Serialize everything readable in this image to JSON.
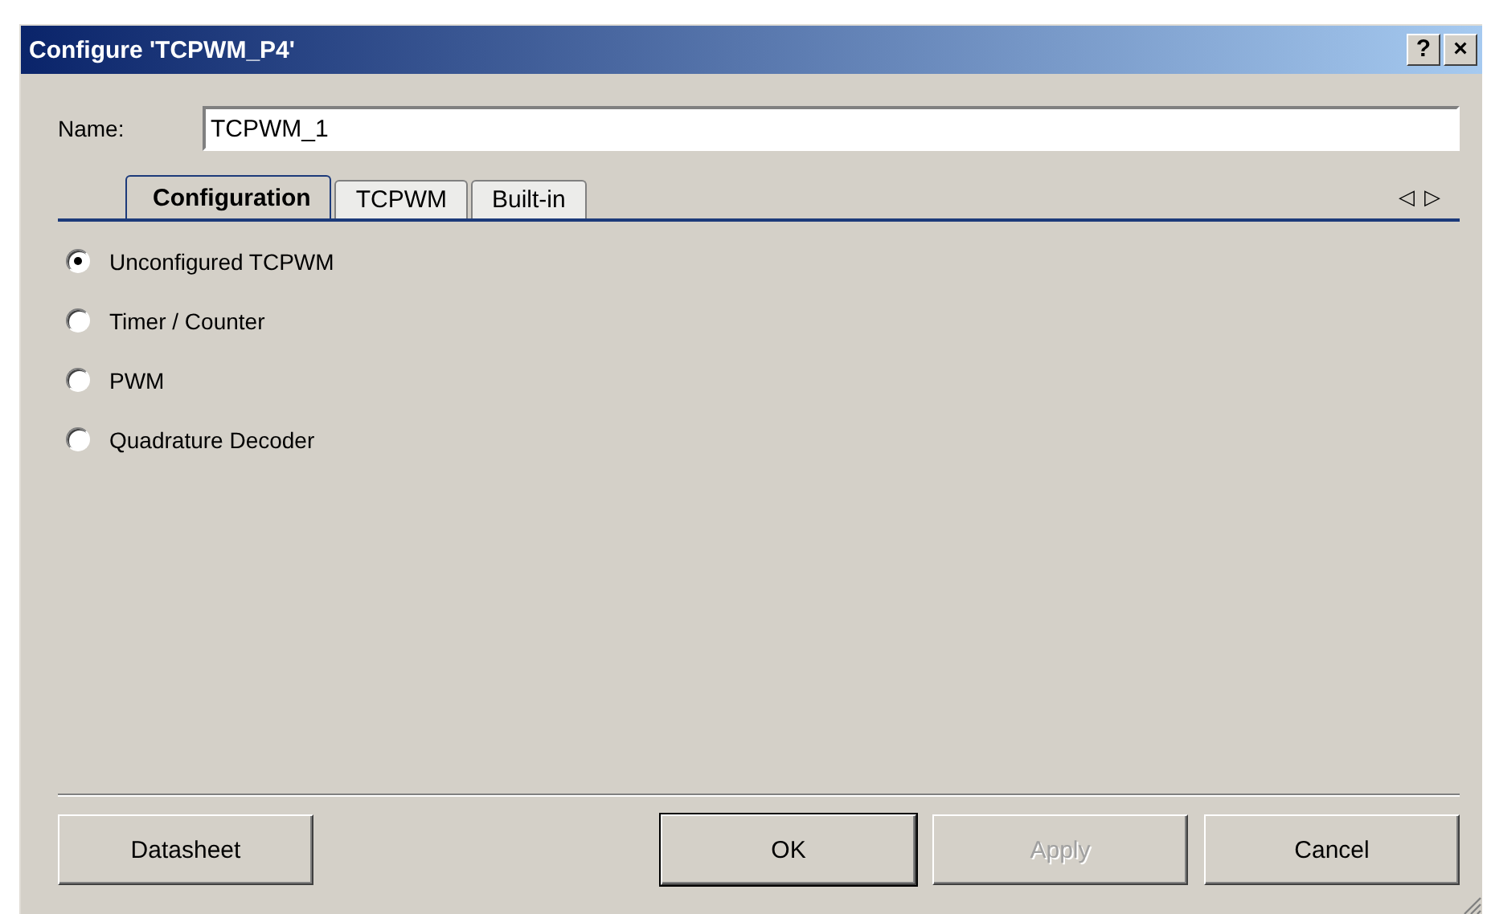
{
  "window": {
    "title": "Configure 'TCPWM_P4'",
    "help_button": "?",
    "close_button": "×"
  },
  "name_field": {
    "label": "Name:",
    "value": "TCPWM_1"
  },
  "tabs": [
    {
      "label": "Configuration",
      "selected": true
    },
    {
      "label": "TCPWM",
      "selected": false
    },
    {
      "label": "Built-in",
      "selected": false
    }
  ],
  "tab_scroll": [
    "◁",
    "▷"
  ],
  "options": [
    {
      "label": "Unconfigured TCPWM",
      "selected": true
    },
    {
      "label": "Timer / Counter",
      "selected": false
    },
    {
      "label": "PWM",
      "selected": false
    },
    {
      "label": "Quadrature Decoder",
      "selected": false
    }
  ],
  "buttons": [
    {
      "label": "Datasheet",
      "default": false,
      "disabled": false
    },
    {
      "label": "OK",
      "default": true,
      "disabled": false
    },
    {
      "label": "Apply",
      "default": false,
      "disabled": true
    },
    {
      "label": "Cancel",
      "default": false,
      "disabled": false
    }
  ]
}
